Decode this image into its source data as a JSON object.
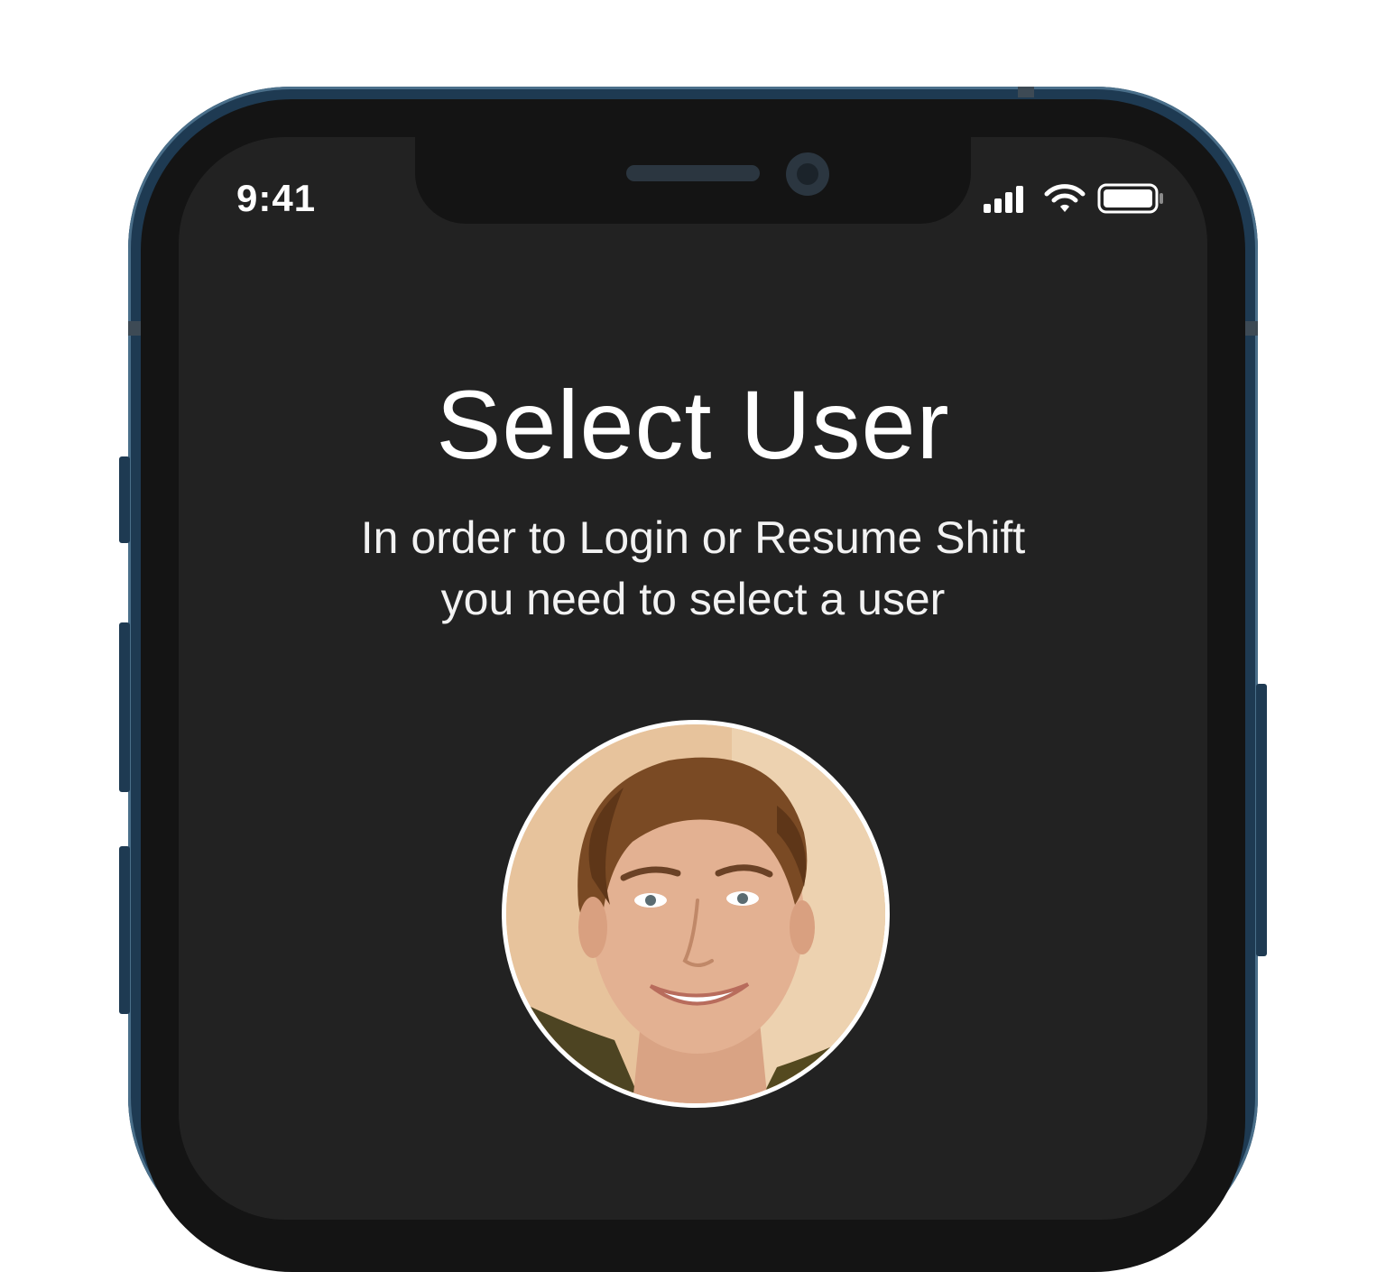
{
  "status_bar": {
    "time": "9:41"
  },
  "screen": {
    "title": "Select User",
    "subtitle_line_1": "In order to Login or Resume Shift",
    "subtitle_line_2": "you need to select a user"
  },
  "icons": {
    "signal": "cellular-signal-icon",
    "wifi": "wifi-icon",
    "battery": "battery-icon"
  },
  "colors": {
    "screen_background": "#222222",
    "frame": "#1e3a52",
    "text": "#ffffff"
  }
}
